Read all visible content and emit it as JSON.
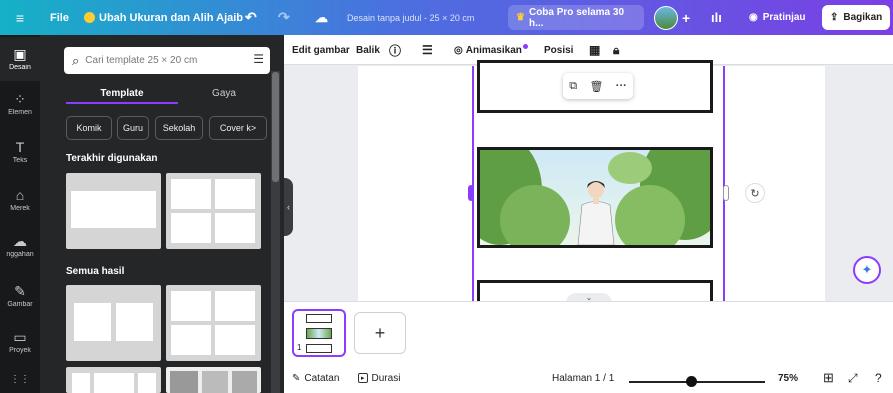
{
  "topbar": {
    "menu_icon": "hamburger-icon",
    "file": "File",
    "promo": "Ubah Ukuran dan Alih Ajaib",
    "undo_icon": "undo-icon",
    "redo_icon": "redo-icon",
    "cloud_icon": "cloud-icon",
    "doc_title": "Desain tanpa judul - 25 × 20 cm",
    "pro_trial": "Coba Pro selama 30 h...",
    "add": "+",
    "preview": "Pratinjau",
    "share": "Bagikan",
    "colors": {
      "gradient_start": "#15b1c7",
      "gradient_end": "#7b3fe4",
      "crown": "#ffcc33"
    }
  },
  "rail": {
    "items": [
      {
        "label": "Desain",
        "icon": "design-icon",
        "glyph": "▣"
      },
      {
        "label": "Elemen",
        "icon": "elements-icon",
        "glyph": "⁘"
      },
      {
        "label": "Teks",
        "icon": "text-icon",
        "glyph": "T"
      },
      {
        "label": "Merek",
        "icon": "brand-icon",
        "glyph": "⌂"
      },
      {
        "label": "nggahan",
        "icon": "upload-icon",
        "glyph": "☁"
      },
      {
        "label": "Gambar",
        "icon": "draw-icon",
        "glyph": "✎"
      },
      {
        "label": "Proyek",
        "icon": "folder-icon",
        "glyph": "▭"
      },
      {
        "label": "",
        "icon": "apps-icon",
        "glyph": "⋮⋮"
      }
    ]
  },
  "panel": {
    "search_placeholder": "Cari template 25 × 20 cm",
    "tabs": [
      "Template",
      "Gaya"
    ],
    "chips": [
      "Komik",
      "Guru",
      "Sekolah",
      "Cover k>"
    ],
    "recent_heading": "Terakhir digunakan",
    "all_heading": "Semua hasil"
  },
  "context_toolbar": {
    "edit_image": "Edit gambar",
    "flip": "Balik",
    "info_icon": "info-icon",
    "lines_icon": "border-style-icon",
    "animate": "Animasikan",
    "position": "Posisi",
    "transparency_icon": "transparency-icon",
    "lock_icon": "lock-icon"
  },
  "canvas": {
    "float_icons": [
      "copy-icon",
      "trash-icon",
      "more-icon"
    ],
    "accent": "#8b3dff"
  },
  "pages": {
    "thumb_number": "1",
    "add_label": "+"
  },
  "footer": {
    "notes": "Catatan",
    "duration": "Durasi",
    "page_indicator": "Halaman 1 / 1",
    "zoom_fraction": 0.46,
    "zoom": "75%"
  }
}
